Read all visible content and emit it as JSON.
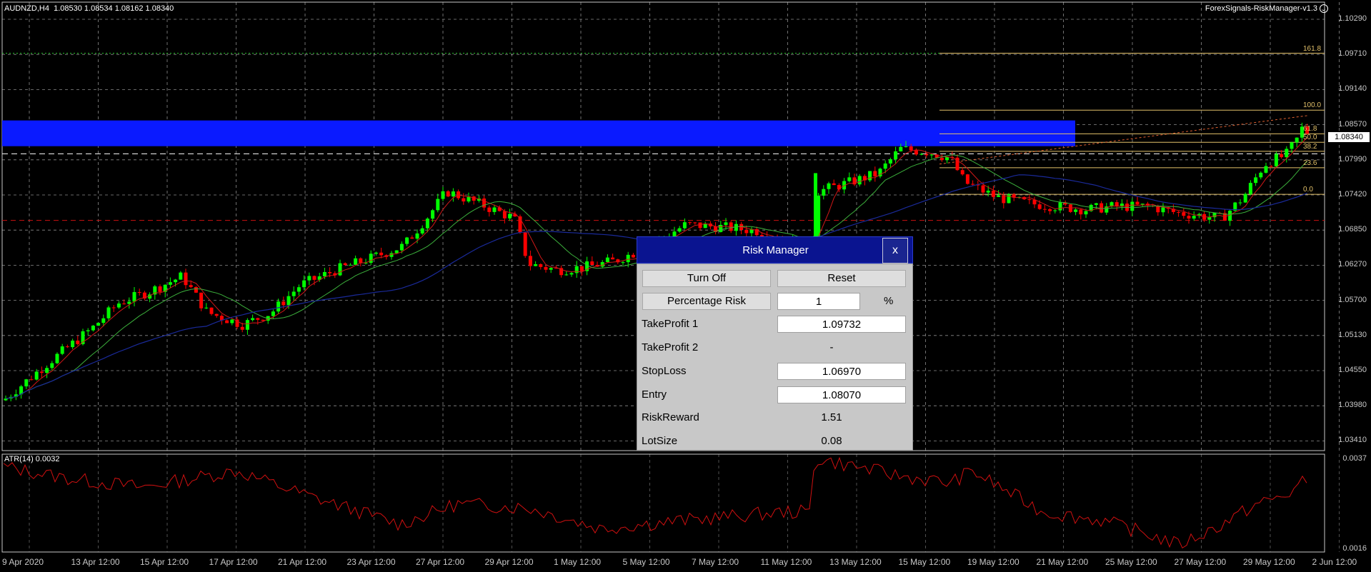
{
  "header": {
    "symbol": "AUDNZD,H4",
    "ohlc": "1.08530 1.08534 1.08162 1.08340",
    "indicator_name": "ForexSignals-RiskManager-v1.3",
    "smiley_icon": "smiley-face-icon"
  },
  "price_axis": {
    "labels": [
      "1.10290",
      "1.09710",
      "1.09140",
      "1.08570",
      "1.07990",
      "1.07420",
      "1.06850",
      "1.06270",
      "1.05700",
      "1.05130",
      "1.04550",
      "1.03980",
      "1.03410"
    ],
    "current_price": "1.08340"
  },
  "atr": {
    "label": "ATR(14) 0.0032",
    "axis_top": "0.0037",
    "axis_bottom": "0.0016"
  },
  "time_axis": [
    "9 Apr 2020",
    "13 Apr 12:00",
    "15 Apr 12:00",
    "17 Apr 12:00",
    "21 Apr 12:00",
    "23 Apr 12:00",
    "27 Apr 12:00",
    "29 Apr 12:00",
    "1 May 12:00",
    "5 May 12:00",
    "7 May 12:00",
    "11 May 12:00",
    "13 May 12:00",
    "15 May 12:00",
    "19 May 12:00",
    "21 May 12:00",
    "25 May 12:00",
    "27 May 12:00",
    "29 May 12:00",
    "2 Jun 12:00"
  ],
  "fibonacci": [
    "161.8",
    "100.0",
    "61.8",
    "50.0",
    "38.2",
    "23.6",
    "0.0"
  ],
  "risk_manager": {
    "title": "Risk Manager",
    "close_label": "x",
    "turn_off_label": "Turn Off",
    "reset_label": "Reset",
    "percentage_risk_label": "Percentage Risk",
    "percentage_risk_value": "1",
    "percent_sign": "%",
    "rows": [
      {
        "label": "TakeProfit 1",
        "value": "1.09732",
        "editable": true
      },
      {
        "label": "TakeProfit 2",
        "value": "-",
        "editable": false
      },
      {
        "label": "StopLoss",
        "value": "1.06970",
        "editable": true
      },
      {
        "label": "Entry",
        "value": "1.08070",
        "editable": true
      },
      {
        "label": "RiskReward",
        "value": "1.51",
        "editable": false
      },
      {
        "label": "LotSize",
        "value": "0.08",
        "editable": false
      }
    ]
  },
  "colors": {
    "bull": "#00ff00",
    "bear": "#ff0000",
    "zone": "#0a1aff",
    "grid": "#c8c8c8",
    "fib": "#e3c16a",
    "atr": "#d01010",
    "ma_fast": "#d01818",
    "ma_mid": "#3cb03c",
    "ma_slow": "#1a2a9a"
  }
}
